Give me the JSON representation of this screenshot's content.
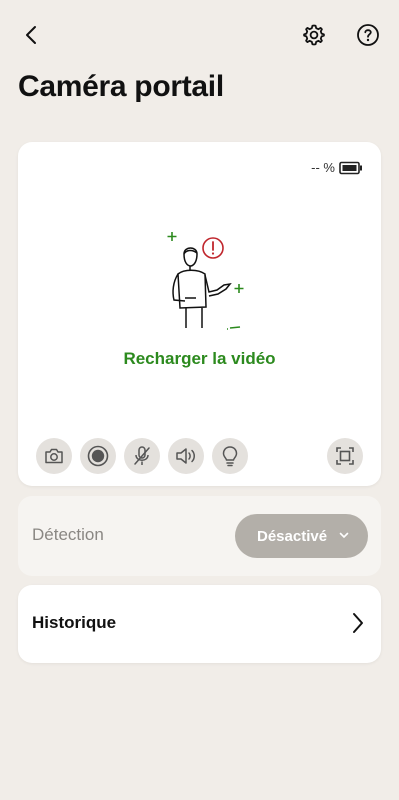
{
  "header": {
    "title": "Caméra portail",
    "back_icon": "chevron-left-icon",
    "settings_icon": "gear-icon",
    "help_icon": "help-circle-icon"
  },
  "video": {
    "battery_text": "-- %",
    "battery_icon": "battery-icon",
    "reload_label": "Recharger la vidéo",
    "error_color": "#c0262d",
    "accent_color": "#2c8a1e",
    "controls": [
      {
        "name": "snapshot",
        "icon": "camera-icon"
      },
      {
        "name": "record",
        "icon": "record-icon"
      },
      {
        "name": "microphone",
        "icon": "microphone-muted-icon"
      },
      {
        "name": "speaker",
        "icon": "speaker-icon"
      },
      {
        "name": "light",
        "icon": "lightbulb-icon"
      },
      {
        "name": "fullscreen",
        "icon": "fullscreen-icon"
      }
    ]
  },
  "detection": {
    "label": "Détection",
    "value": "Désactivé"
  },
  "history": {
    "label": "Historique"
  }
}
